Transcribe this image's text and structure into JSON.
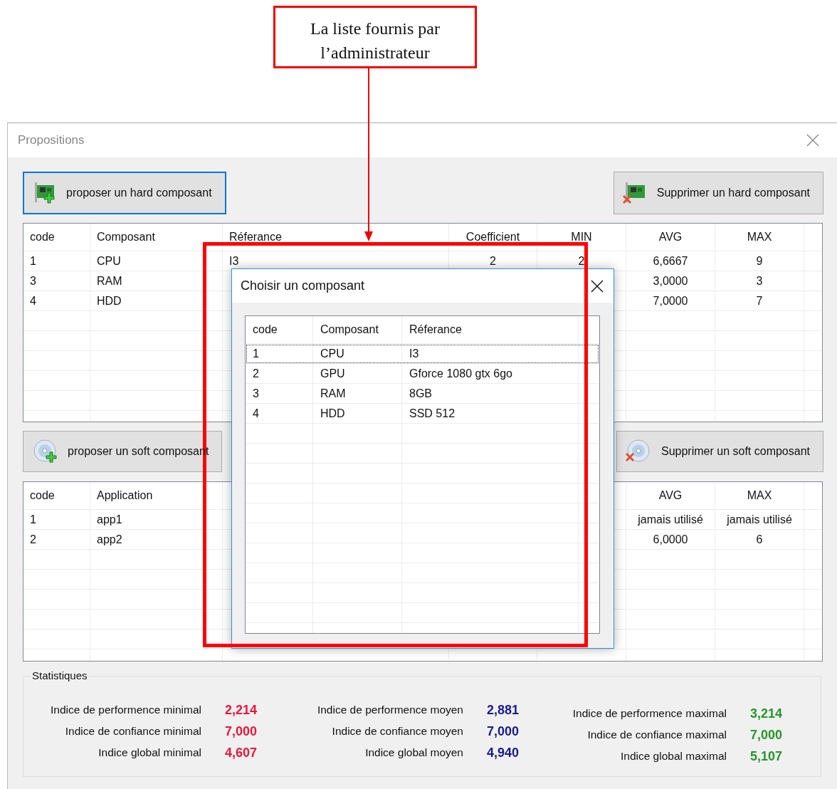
{
  "annotation": {
    "text": "La liste fournis par l’administrateur"
  },
  "window": {
    "title": "Propositions"
  },
  "hard": {
    "buttons": [
      {
        "label": "proposer un hard composant",
        "focused": true
      },
      {
        "label": "Supprimer un hard composant",
        "focused": false
      }
    ],
    "table": {
      "columns": [
        "code",
        "Composant",
        "Réferance",
        "Coefficient",
        "MIN",
        "AVG",
        "MAX"
      ],
      "rows": [
        [
          "1",
          "CPU",
          "I3",
          "2",
          "2",
          "6,6667",
          "9"
        ],
        [
          "3",
          "RAM",
          null,
          null,
          null,
          "3,0000",
          "3"
        ],
        [
          "4",
          "HDD",
          null,
          null,
          null,
          "7,0000",
          "7"
        ]
      ]
    }
  },
  "soft": {
    "buttons": [
      {
        "label": "proposer un soft composant",
        "focused": false
      },
      {
        "label": "Supprimer un soft composant",
        "focused": false
      }
    ],
    "table": {
      "columns": [
        "code",
        "Application",
        null,
        null,
        null,
        "AVG",
        "MAX"
      ],
      "rows": [
        [
          "1",
          "app1",
          null,
          null,
          null,
          "jamais utilisé",
          "jamais utilisé"
        ],
        [
          "2",
          "app2",
          null,
          null,
          null,
          "6,0000",
          "6"
        ]
      ]
    }
  },
  "stats": {
    "title": "Statistiques",
    "columns": [
      {
        "color": "#e8173c",
        "items": [
          {
            "label": "Indice de performence minimal",
            "value": "2,214"
          },
          {
            "label": "Indice de confiance minimal",
            "value": "7,000"
          },
          {
            "label": "Indice global minimal",
            "value": "4,607"
          }
        ]
      },
      {
        "color": "#1a1a8c",
        "items": [
          {
            "label": "Indice de performence moyen",
            "value": "2,881"
          },
          {
            "label": "Indice de confiance moyen",
            "value": "7,000"
          },
          {
            "label": "Indice global moyen",
            "value": "4,940"
          }
        ]
      },
      {
        "color": "#27962a",
        "items": [
          {
            "label": "Indice de performence maximal",
            "value": "3,214"
          },
          {
            "label": "Indice de confiance maximal",
            "value": "7,000"
          },
          {
            "label": "Indice global maximal",
            "value": "5,107"
          }
        ]
      }
    ]
  },
  "dialog": {
    "title": "Choisir un composant",
    "columns": [
      "code",
      "Composant",
      "Réferance"
    ],
    "rows": [
      {
        "cells": [
          "1",
          "CPU",
          "I3"
        ],
        "selected": true
      },
      {
        "cells": [
          "2",
          "GPU",
          "Gforce 1080 gtx 6go"
        ],
        "selected": false
      },
      {
        "cells": [
          "3",
          "RAM",
          "8GB"
        ],
        "selected": false
      },
      {
        "cells": [
          "4",
          "HDD",
          "SSD 512"
        ],
        "selected": false
      }
    ]
  }
}
